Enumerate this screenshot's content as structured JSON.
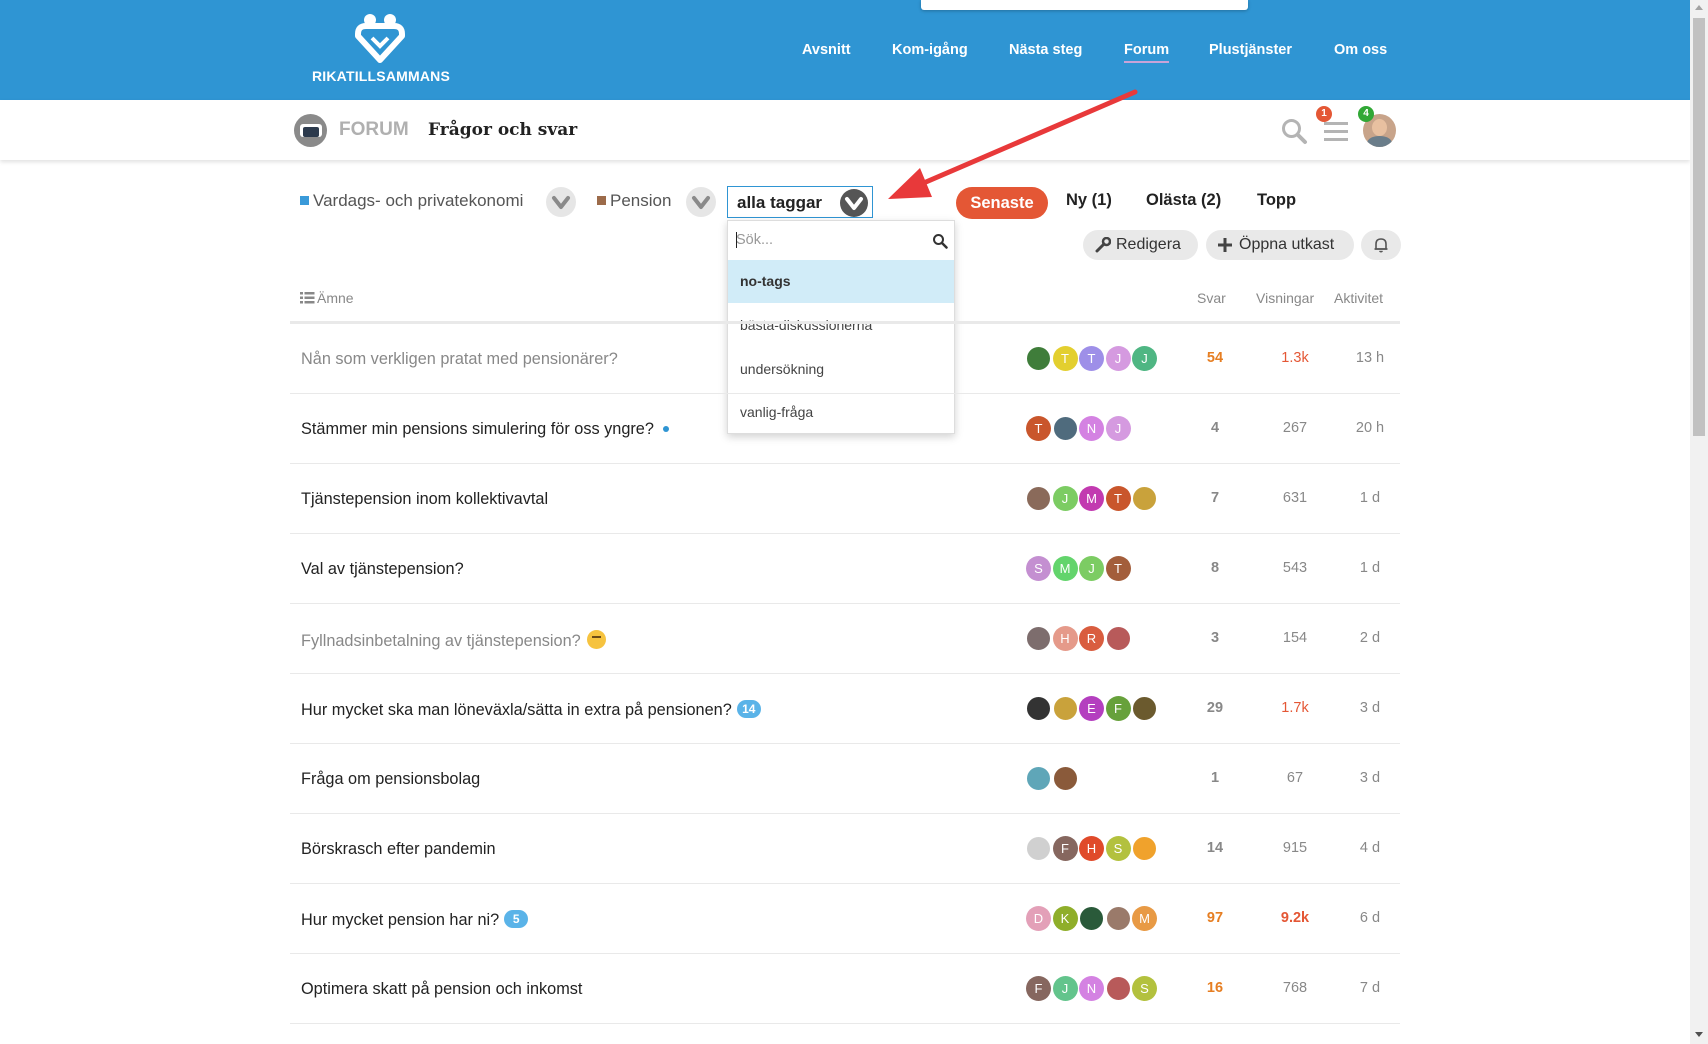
{
  "brand": {
    "name": "RIKATILLSAMMANS"
  },
  "main_nav": [
    "Avsnitt",
    "Kom-igång",
    "Nästa steg",
    "Forum",
    "Plustjänster",
    "Om oss"
  ],
  "main_nav_active": "Forum",
  "forum_header": {
    "forum_word": "FORUM",
    "title": "Frågor och svar",
    "notifications_badge": "1",
    "messages_badge": "4"
  },
  "filters": {
    "category": "Vardags- och privatekonomi",
    "subcategory": "Pension",
    "tag_select": "alla taggar",
    "tag_search_placeholder": "Sök...",
    "tag_options": [
      "no-tags",
      "bästa-diskussionerna",
      "undersökning",
      "vanlig-fråga"
    ]
  },
  "list_nav": {
    "latest": "Senaste",
    "new": "Ny (1)",
    "unread": "Olästa (2)",
    "top": "Topp"
  },
  "buttons": {
    "edit": "Redigera",
    "open_draft": "Öppna utkast"
  },
  "columns": {
    "topic": "Ämne",
    "replies": "Svar",
    "views": "Visningar",
    "activity": "Aktivitet"
  },
  "topics": [
    {
      "title": "Nån som verkligen pratat med pensionärer?",
      "replies": "54",
      "views": "1.3k",
      "activity": "13 h",
      "posters": [
        {
          "l": "",
          "c": "#3f7d3a"
        },
        {
          "l": "T",
          "c": "#e3cf2f"
        },
        {
          "l": "T",
          "c": "#9e8fe8"
        },
        {
          "l": "J",
          "c": "#d59ae0"
        },
        {
          "l": "J",
          "c": "#4fb683"
        }
      ]
    },
    {
      "title": "Stämmer min pensions simulering för oss yngre?",
      "replies": "4",
      "views": "267",
      "activity": "20 h",
      "posters": [
        {
          "l": "T",
          "c": "#c9562c"
        },
        {
          "l": "",
          "c": "#4f6b7d"
        },
        {
          "l": "N",
          "c": "#d482e2"
        },
        {
          "l": "J",
          "c": "#d59ae0"
        }
      ]
    },
    {
      "title": "Tjänstepension inom kollektivavtal",
      "replies": "7",
      "views": "631",
      "activity": "1 d",
      "posters": [
        {
          "l": "",
          "c": "#8a6a5a"
        },
        {
          "l": "J",
          "c": "#7ccc63"
        },
        {
          "l": "M",
          "c": "#c23ab0"
        },
        {
          "l": "T",
          "c": "#c9562c"
        },
        {
          "l": "",
          "c": "#c9a23b"
        }
      ]
    },
    {
      "title": "Val av tjänstepension?",
      "replies": "8",
      "views": "543",
      "activity": "1 d",
      "posters": [
        {
          "l": "S",
          "c": "#c48fd1"
        },
        {
          "l": "M",
          "c": "#63d46c"
        },
        {
          "l": "J",
          "c": "#7ccc63"
        },
        {
          "l": "T",
          "c": "#a35e3b"
        }
      ]
    },
    {
      "title": "Fyllnadsinbetalning av tjänstepension?",
      "replies": "3",
      "views": "154",
      "activity": "2 d",
      "posters": [
        {
          "l": "",
          "c": "#7d6d6d"
        },
        {
          "l": "H",
          "c": "#e59a8a"
        },
        {
          "l": "R",
          "c": "#d95d3f"
        },
        {
          "l": "",
          "c": "#b85a5a"
        }
      ]
    },
    {
      "title": "Hur mycket ska man löneväxla/sätta in extra på pensionen?",
      "unread": "14",
      "replies": "29",
      "views": "1.7k",
      "activity": "3 d",
      "posters": [
        {
          "l": "",
          "c": "#333333"
        },
        {
          "l": "",
          "c": "#c9a23b"
        },
        {
          "l": "E",
          "c": "#b43fbf"
        },
        {
          "l": "F",
          "c": "#67a13b"
        },
        {
          "l": "",
          "c": "#6b5a2e"
        }
      ]
    },
    {
      "title": "Fråga om pensionsbolag",
      "replies": "1",
      "views": "67",
      "activity": "3 d",
      "posters": [
        {
          "l": "",
          "c": "#5fa6b8"
        },
        {
          "l": "",
          "c": "#8a5a3a"
        }
      ]
    },
    {
      "title": "Börskrasch efter pandemin",
      "replies": "14",
      "views": "915",
      "activity": "4 d",
      "posters": [
        {
          "l": "",
          "c": "#d0d0d0"
        },
        {
          "l": "F",
          "c": "#86675f"
        },
        {
          "l": "H",
          "c": "#e04a2a"
        },
        {
          "l": "S",
          "c": "#b3c13e"
        },
        {
          "l": "",
          "c": "#f0a22c"
        }
      ]
    },
    {
      "title": "Hur mycket pension har ni?",
      "unread": "5",
      "replies": "97",
      "views": "9.2k",
      "activity": "6 d",
      "posters": [
        {
          "l": "D",
          "c": "#e3a0b8"
        },
        {
          "l": "K",
          "c": "#8fae2a"
        },
        {
          "l": "",
          "c": "#2a5a3a"
        },
        {
          "l": "",
          "c": "#9a7a6a"
        },
        {
          "l": "M",
          "c": "#e89a45"
        }
      ]
    },
    {
      "title": "Optimera skatt på pension och inkomst",
      "replies": "16",
      "views": "768",
      "activity": "7 d",
      "posters": [
        {
          "l": "F",
          "c": "#86675f"
        },
        {
          "l": "J",
          "c": "#63c48c"
        },
        {
          "l": "N",
          "c": "#d482e2"
        },
        {
          "l": "",
          "c": "#b85a5a"
        },
        {
          "l": "S",
          "c": "#b3c13e"
        }
      ]
    }
  ],
  "colors": {
    "header_blue": "#2f95d3",
    "accent_red": "#e45735",
    "hot_orange": "#e67e22",
    "selected_option_bg": "#d1ecf8"
  }
}
